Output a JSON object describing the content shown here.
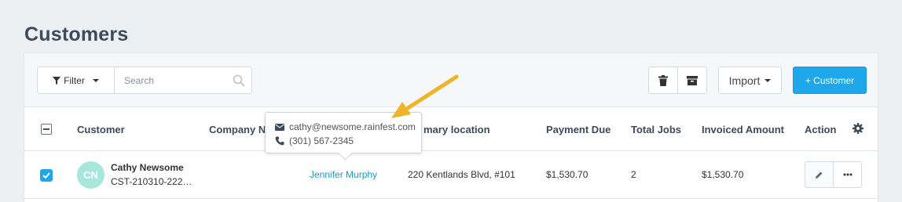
{
  "page": {
    "title": "Customers"
  },
  "toolbar": {
    "filter_label": "Filter",
    "search_placeholder": "Search",
    "import_label": "Import",
    "add_label": "+ Customer"
  },
  "table": {
    "headers": {
      "customer": "Customer",
      "company": "Company Na",
      "location": "mary location",
      "payment_due": "Payment Due",
      "total_jobs": "Total Jobs",
      "invoiced": "Invoiced Amount",
      "action": "Action"
    },
    "rows": [
      {
        "selected": true,
        "initials": "CN",
        "name": "Cathy Newsome",
        "id": "CST-210310-222…",
        "contact": "Jennifer Murphy",
        "location": "220 Kentlands Blvd, #101",
        "payment_due": "$1,530.70",
        "total_jobs": "2",
        "invoiced": "$1,530.70"
      }
    ]
  },
  "tooltip": {
    "email": "cathy@newsome.rainfest.com",
    "phone": "(301) 567-2345"
  },
  "colors": {
    "accent": "#1ea7ea",
    "avatar": "#a7e6da",
    "annotation_arrow": "#f0b429",
    "link": "#1a9bc4"
  },
  "icons": [
    "filter-icon",
    "search-icon",
    "trash-icon",
    "archive-icon",
    "gear-icon",
    "check-icon",
    "pencil-icon",
    "more-icon",
    "envelope-icon",
    "phone-icon"
  ]
}
